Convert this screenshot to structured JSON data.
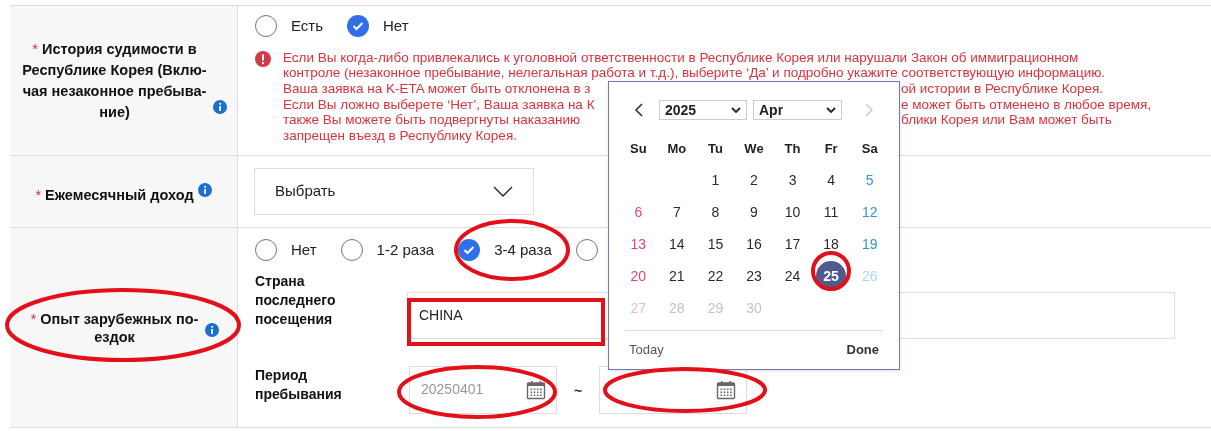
{
  "rows": [
    {
      "kind": "radio_warning",
      "label": "История судимости в Республике Корея (Вклю-чая незаконное пребыва-ние)",
      "marker": "*",
      "options": [
        {
          "label": "Есть",
          "selected": false
        },
        {
          "label": "Нет",
          "selected": true
        }
      ],
      "warning_lines": [
        {
          "left": "Если Вы когда-либо привлекались к уголовной ответственности в Республике Корея или нарушали Закон об иммиграционном"
        },
        {
          "left": "контроле (незаконное пребывание, нелегальная работа и т.д.), выберите ‘Да’ и подробно укажите соответствующую информацию."
        },
        {
          "left": "Ваша заявка на K-ETA может быть отклонена в з",
          "right": "ой истории в Республике Корея."
        },
        {
          "left": "Если Вы ложно выберете ‘Нет’, Ваша заявка на К",
          "right": "е может быть отменено в любое время,"
        },
        {
          "left": "также Вы можете быть подвергнуты наказанию",
          "right": "блики Корея или Вам может быть"
        },
        {
          "left": "запрещен въезд в Республику Корея."
        }
      ]
    },
    {
      "kind": "select",
      "label": "Ежемесячный доход",
      "marker": "*",
      "select": {
        "value": "Выбрать"
      }
    },
    {
      "kind": "travel",
      "label": "Опыт зарубежных по-ездок",
      "marker": "*",
      "options": [
        {
          "label": "Нет",
          "selected": false
        },
        {
          "label": "1-2 раза",
          "selected": false
        },
        {
          "label": "3-4 раза",
          "selected": true
        },
        {
          "selected": false
        }
      ],
      "country": {
        "label": "Страна последнего посещения",
        "value": "CHINA"
      },
      "period": {
        "label": "Период пребывания",
        "from": "20250401",
        "separator": "~"
      }
    }
  ],
  "calendar": {
    "year": "2025",
    "month": "Apr",
    "prev_disabled": false,
    "next_disabled": true,
    "weekdays": [
      "Su",
      "Mo",
      "Tu",
      "We",
      "Th",
      "Fr",
      "Sa"
    ],
    "weeks": [
      [
        {
          "kind": "empty"
        },
        {
          "kind": "empty"
        },
        {
          "kind": "day",
          "label": "1",
          "selected": false,
          "disabled": false
        },
        {
          "kind": "day",
          "label": "2",
          "selected": false,
          "disabled": false
        },
        {
          "kind": "day",
          "label": "3",
          "selected": false,
          "disabled": false
        },
        {
          "kind": "day",
          "label": "4",
          "selected": false,
          "disabled": false
        },
        {
          "kind": "day",
          "label": "5",
          "selected": false,
          "disabled": false
        }
      ],
      [
        {
          "kind": "day",
          "label": "6",
          "selected": false,
          "disabled": false
        },
        {
          "kind": "day",
          "label": "7",
          "selected": false,
          "disabled": false
        },
        {
          "kind": "day",
          "label": "8",
          "selected": false,
          "disabled": false
        },
        {
          "kind": "day",
          "label": "9",
          "selected": false,
          "disabled": false
        },
        {
          "kind": "day",
          "label": "10",
          "selected": false,
          "disabled": false
        },
        {
          "kind": "day",
          "label": "11",
          "selected": false,
          "disabled": false
        },
        {
          "kind": "day",
          "label": "12",
          "selected": false,
          "disabled": false
        }
      ],
      [
        {
          "kind": "day",
          "label": "13",
          "selected": false,
          "disabled": false
        },
        {
          "kind": "day",
          "label": "14",
          "selected": false,
          "disabled": false
        },
        {
          "kind": "day",
          "label": "15",
          "selected": false,
          "disabled": false
        },
        {
          "kind": "day",
          "label": "16",
          "selected": false,
          "disabled": false
        },
        {
          "kind": "day",
          "label": "17",
          "selected": false,
          "disabled": false
        },
        {
          "kind": "day",
          "label": "18",
          "selected": false,
          "disabled": false
        },
        {
          "kind": "day",
          "label": "19",
          "selected": false,
          "disabled": false
        }
      ],
      [
        {
          "kind": "day",
          "label": "20",
          "selected": false,
          "disabled": false
        },
        {
          "kind": "day",
          "label": "21",
          "selected": false,
          "disabled": false
        },
        {
          "kind": "day",
          "label": "22",
          "selected": false,
          "disabled": false
        },
        {
          "kind": "day",
          "label": "23",
          "selected": false,
          "disabled": false
        },
        {
          "kind": "day",
          "label": "24",
          "selected": false,
          "disabled": false
        },
        {
          "kind": "day",
          "label": "25",
          "selected": true,
          "disabled": false
        },
        {
          "kind": "day",
          "label": "26",
          "selected": false,
          "disabled": true
        }
      ],
      [
        {
          "kind": "day",
          "label": "27",
          "selected": false,
          "disabled": true
        },
        {
          "kind": "day",
          "label": "28",
          "selected": false,
          "disabled": true
        },
        {
          "kind": "day",
          "label": "29",
          "selected": false,
          "disabled": true
        },
        {
          "kind": "day",
          "label": "30",
          "selected": false,
          "disabled": true
        },
        {
          "kind": "empty"
        },
        {
          "kind": "empty"
        },
        {
          "kind": "empty"
        }
      ]
    ],
    "today": "Today",
    "done": "Done"
  }
}
